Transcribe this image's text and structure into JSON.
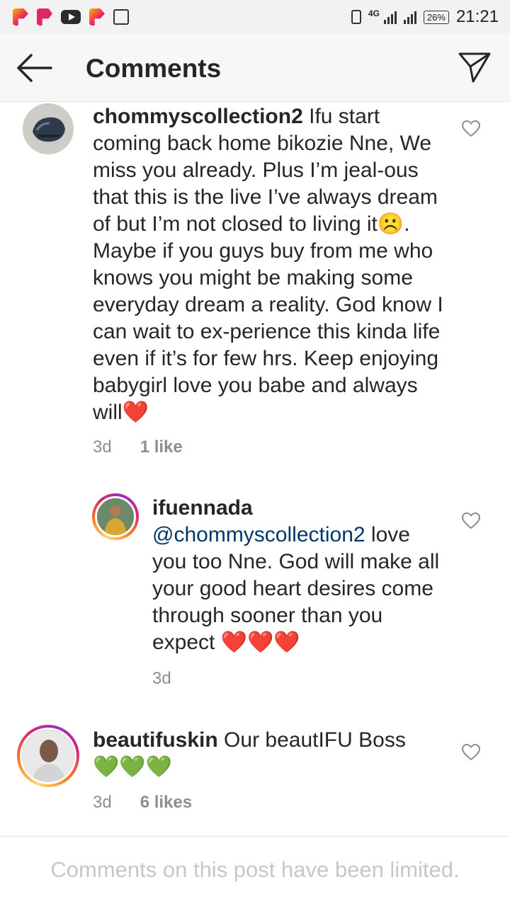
{
  "status_bar": {
    "network": "4G",
    "battery": "26%",
    "time": "21:21"
  },
  "header": {
    "title": "Comments"
  },
  "comments": [
    {
      "username": "chommyscollection2",
      "text": "Ifu start coming back home bikozie Nne, We miss you already. Plus I’m jeal-ous that this is the live I’ve always dream of but I’m not closed to living it☹️. Maybe if you guys buy from me who knows you might be making some everyday dream a reality. God know I can wait to ex-perience this kinda life even if it’s for few hrs. Keep enjoying babygirl love you babe and always will❤️",
      "time": "3d",
      "likes": "1 like"
    },
    {
      "username": "ifuennada",
      "mention": "@chommyscollection2",
      "text": "love you too Nne. God will make all your good heart desires come through sooner than you expect ❤️❤️❤️",
      "time": "3d"
    },
    {
      "username": "beautifuskin",
      "text": "Our beautIFU Boss 💚💚💚",
      "time": "3d",
      "likes": "6 likes"
    }
  ],
  "footer": {
    "note": "Comments on this post have been limited."
  },
  "icons": {
    "back": "arrow-left-icon",
    "send": "paper-plane-icon",
    "like": "heart-outline-icon"
  },
  "colors": {
    "heart_pink": "#e8488a",
    "heart_green": "#8bc34a",
    "mention_blue": "#00376b",
    "muted": "#8e8e8e"
  }
}
